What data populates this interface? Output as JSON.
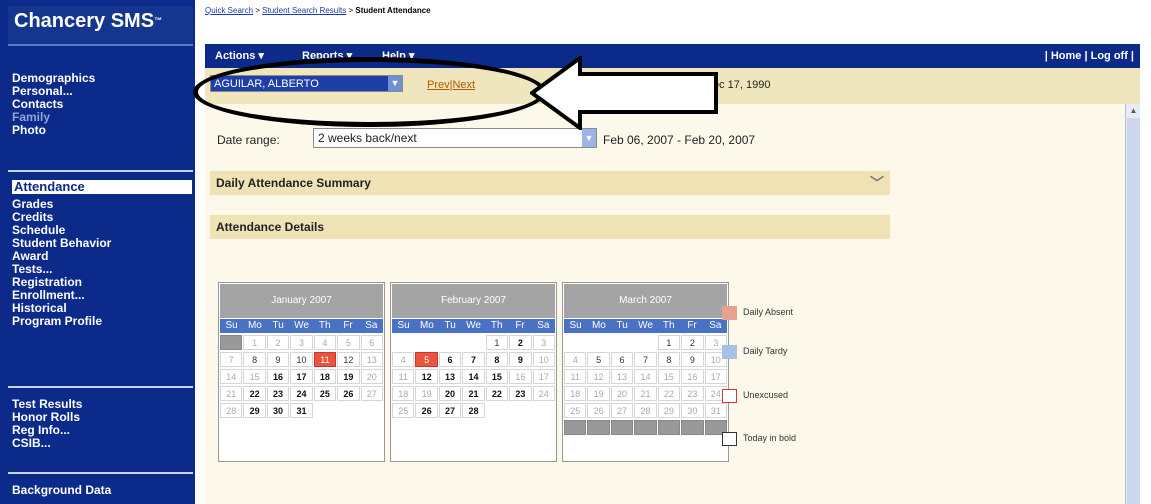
{
  "app": {
    "title": "Chancery SMS",
    "tm": "™"
  },
  "breadcrumb": {
    "items": [
      "Quick Search",
      "Student Search Results"
    ],
    "separator": ">",
    "current": "Student Attendance"
  },
  "sidebar": {
    "group1": [
      "Demographics",
      "Personal...",
      "Contacts",
      "Family",
      "Photo"
    ],
    "active": "Attendance",
    "group2": [
      "Grades",
      "Credits",
      "Schedule",
      "Student Behavior",
      "Award",
      "Tests...",
      "Registration",
      "Enrollment...",
      "Historical",
      "Program Profile"
    ],
    "group3": [
      "Test Results",
      "Honor Rolls",
      "Reg Info...",
      "CSIB..."
    ],
    "group4": [
      "Background Data"
    ]
  },
  "menubar": {
    "actions": "Actions ▾",
    "reports": "Reports ▾",
    "help": "Help ▾",
    "home": "| Home | Log off |"
  },
  "student": {
    "name": "AGUILAR, ALBERTO",
    "prev": "Prev",
    "next": "Next",
    "dob": "Dec 17, 1990"
  },
  "daterange": {
    "label": "Date range:",
    "value": "2 weeks back/next",
    "range": "Feb 06, 2007 - Feb 20, 2007"
  },
  "sections": {
    "summary": "Daily Attendance Summary",
    "details": "Attendance Details"
  },
  "calendars": [
    {
      "title": "January 2007",
      "days": [
        "Su",
        "Mo",
        "Tu",
        "We",
        "Th",
        "Fr",
        "Sa"
      ]
    },
    {
      "title": "February 2007",
      "days": [
        "Su",
        "Mo",
        "Tu",
        "We",
        "Th",
        "Fr",
        "Sa"
      ]
    },
    {
      "title": "March 2007",
      "days": [
        "Su",
        "Mo",
        "Tu",
        "We",
        "Th",
        "Fr",
        "Sa"
      ]
    }
  ],
  "legend": {
    "absent": "Daily Absent",
    "tardy": "Daily Tardy",
    "unexcused": "Unexcused",
    "today": "Today in bold"
  },
  "colors": {
    "sidebar": "#0c2a8a",
    "absent": "#e8553a",
    "tardy": "#a6c1e6",
    "header": "#efe6bd"
  }
}
